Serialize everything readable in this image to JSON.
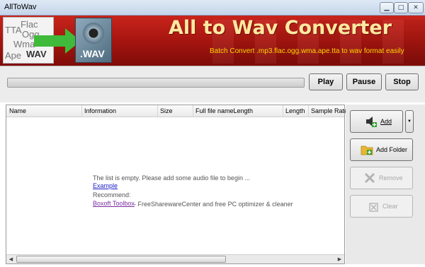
{
  "window": {
    "title": "AllToWav",
    "controls": [
      "minimize",
      "maximize",
      "close"
    ]
  },
  "banner": {
    "headline": "All to Wav Converter",
    "subline": "Batch Convert .mp3.flac.ogg.wma.ape.tta to wav format easily",
    "logo_formats": [
      "TTA",
      "Flac",
      "Ogg",
      "Wma",
      "Ape"
    ],
    "logo_target": "WAV",
    "speaker_label": ".WAV"
  },
  "transport": {
    "progress": 0,
    "play_label": "Play",
    "pause_label": "Pause",
    "stop_label": "Stop"
  },
  "list": {
    "columns": [
      "Name",
      "Information",
      "Size",
      "Full file nameLength",
      "Length",
      "Sample Rate"
    ],
    "empty_message": "The list is empty. Please add some audio file to begin ...",
    "example_link": "Example",
    "recommend_label": "Recommend:",
    "recommend_link": "Boxoft Toolbox",
    "recommend_desc": "- FreeSharewareCenter and free PC optimizer & cleaner"
  },
  "actions": {
    "add_label": "Add",
    "add_folder_label": "Add Folder",
    "remove_label": "Remove",
    "clear_label": "Clear"
  },
  "colors": {
    "banner": "#b01a12",
    "headline": "#ffe9a0",
    "subline": "#ffd600",
    "link": "#1a1ac8"
  }
}
